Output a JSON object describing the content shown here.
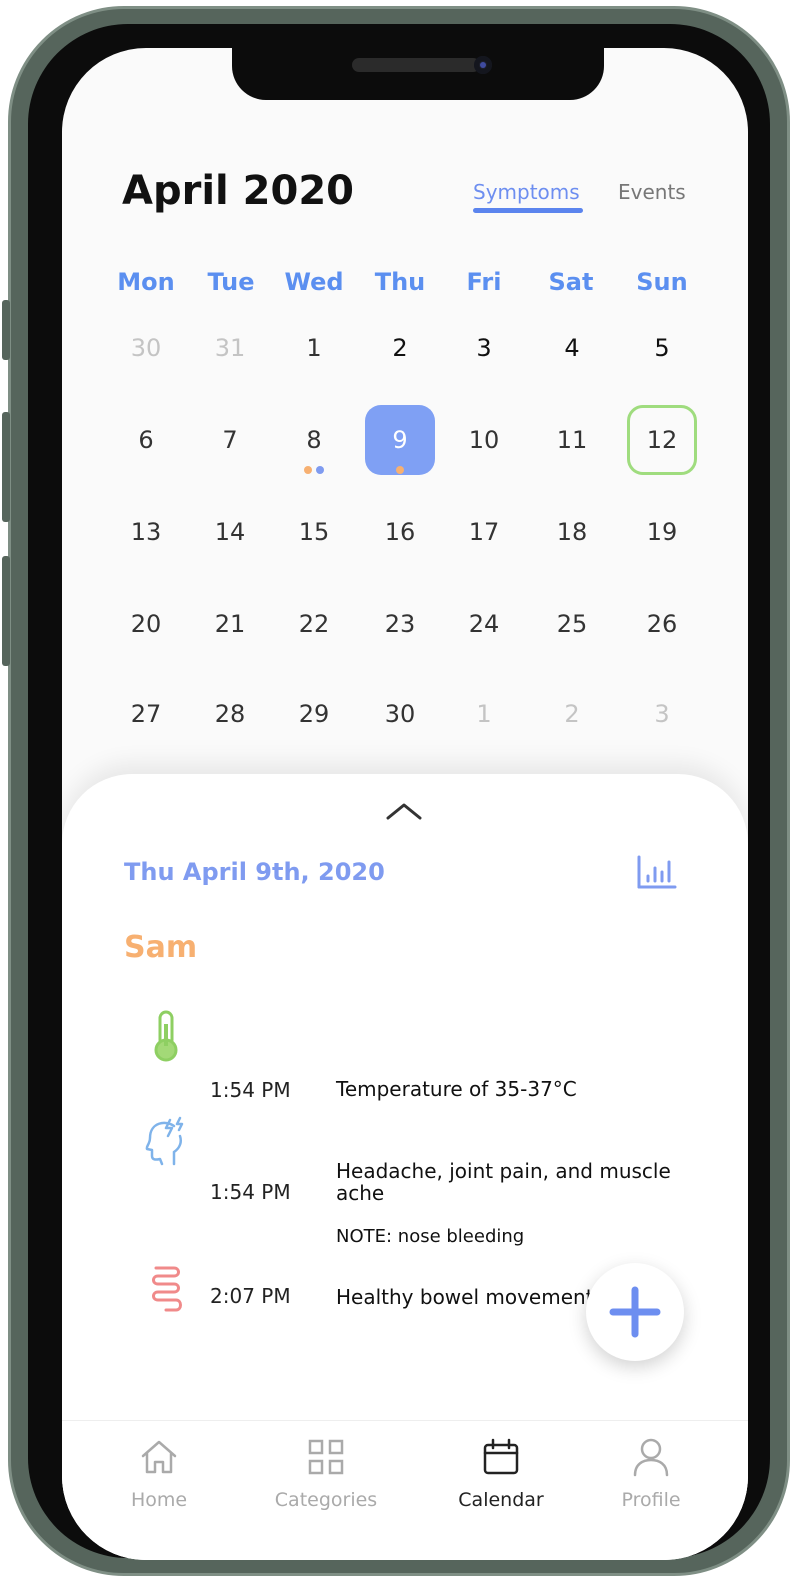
{
  "calendar": {
    "month_title": "April 2020",
    "tabs": [
      {
        "label": "Symptoms",
        "active": true
      },
      {
        "label": "Events",
        "active": false
      }
    ],
    "weekdays": [
      "Mon",
      "Tue",
      "Wed",
      "Thu",
      "Fri",
      "Sat",
      "Sun"
    ],
    "weeks": [
      [
        {
          "d": "30",
          "s": "muted"
        },
        {
          "d": "31",
          "s": "muted"
        },
        {
          "d": "1"
        },
        {
          "d": "2",
          "s": "dark"
        },
        {
          "d": "3",
          "s": "dark"
        },
        {
          "d": "4",
          "s": "dark"
        },
        {
          "d": "5",
          "s": "dark"
        }
      ],
      [
        {
          "d": "6"
        },
        {
          "d": "7"
        },
        {
          "d": "8",
          "dots": [
            "#f7b071",
            "#7f9bf0"
          ]
        },
        {
          "d": "9",
          "s": "selected",
          "dots": [
            "#f7b071"
          ]
        },
        {
          "d": "10"
        },
        {
          "d": "11"
        },
        {
          "d": "12",
          "s": "today"
        }
      ],
      [
        {
          "d": "13"
        },
        {
          "d": "14"
        },
        {
          "d": "15"
        },
        {
          "d": "16"
        },
        {
          "d": "17"
        },
        {
          "d": "18"
        },
        {
          "d": "19"
        }
      ],
      [
        {
          "d": "20"
        },
        {
          "d": "21"
        },
        {
          "d": "22"
        },
        {
          "d": "23"
        },
        {
          "d": "24"
        },
        {
          "d": "25"
        },
        {
          "d": "26"
        }
      ],
      [
        {
          "d": "27"
        },
        {
          "d": "28"
        },
        {
          "d": "29"
        },
        {
          "d": "30"
        },
        {
          "d": "1",
          "s": "muted"
        },
        {
          "d": "2",
          "s": "muted"
        },
        {
          "d": "3",
          "s": "muted"
        }
      ]
    ],
    "colors": {
      "accent": "#5b8ff0",
      "selected_bg": "#7fa0f4",
      "today_border": "#9fdc7e",
      "dot_orange": "#f7b071",
      "dot_blue": "#7f9bf0"
    }
  },
  "details": {
    "date_heading": "Thu April 9th, 2020",
    "person_name": "Sam",
    "entries": [
      {
        "icon": "thermometer-icon",
        "time": "1:54 PM",
        "description": "Temperature of 35-37°C",
        "note": ""
      },
      {
        "icon": "head-pain-icon",
        "time": "1:54 PM",
        "description": "Headache, joint pain, and muscle ache",
        "note": "NOTE: nose bleeding"
      },
      {
        "icon": "intestine-icon",
        "time": "2:07 PM",
        "description": "Healthy bowel movement",
        "note": ""
      }
    ]
  },
  "nav": [
    {
      "label": "Home",
      "icon": "home-icon",
      "active": false
    },
    {
      "label": "Categories",
      "icon": "grid-icon",
      "active": false
    },
    {
      "label": "Calendar",
      "icon": "calendar-icon",
      "active": true
    },
    {
      "label": "Profile",
      "icon": "person-icon",
      "active": false
    }
  ]
}
